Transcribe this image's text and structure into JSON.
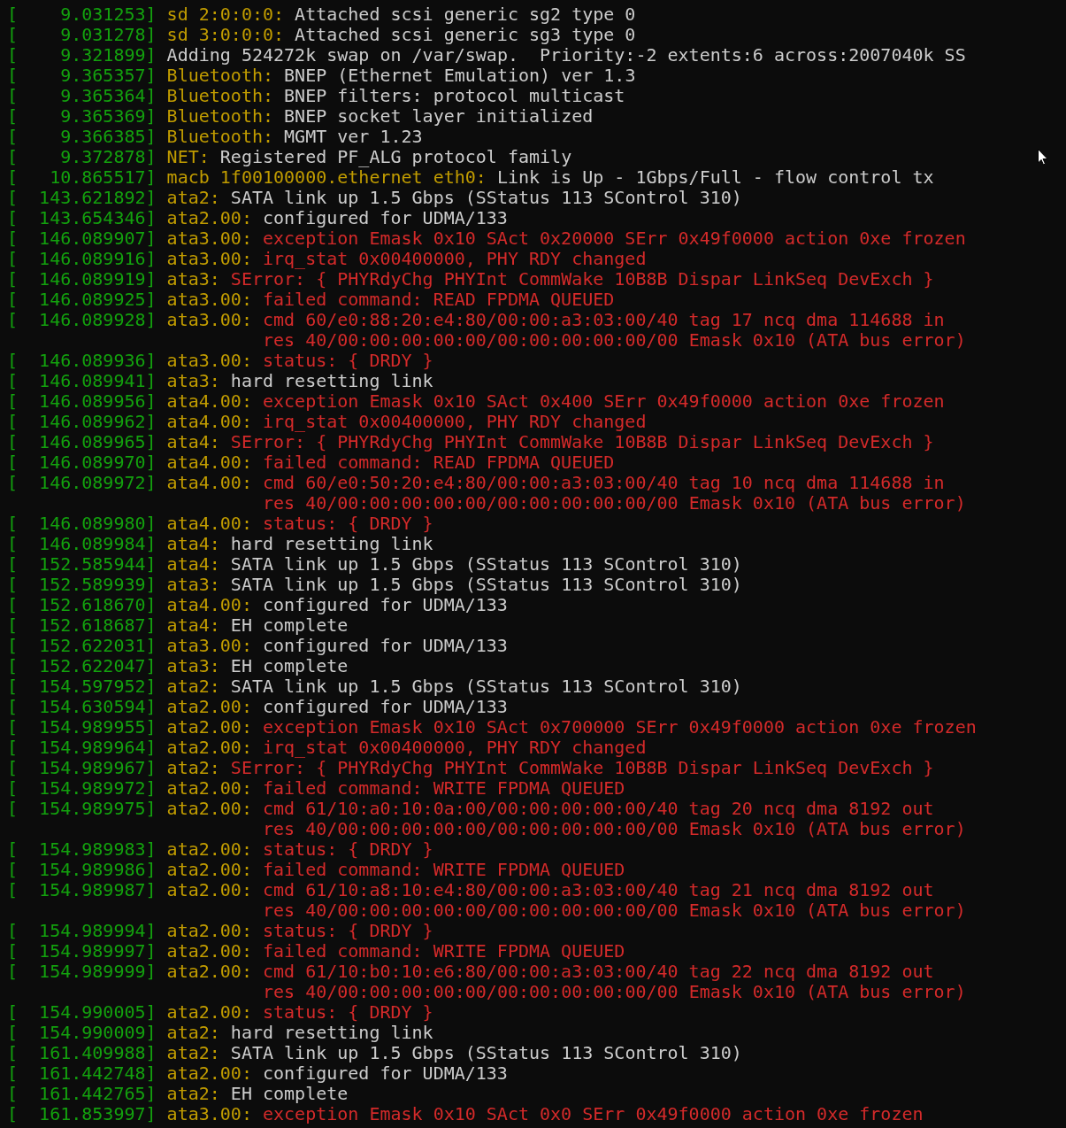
{
  "lines": [
    {
      "timestamp": "[    9.031253]",
      "source": "sd 2:0:0:0:",
      "message": "Attached scsi generic sg2 type 0",
      "kind": "info"
    },
    {
      "timestamp": "[    9.031278]",
      "source": "sd 3:0:0:0:",
      "message": "Attached scsi generic sg3 type 0",
      "kind": "info"
    },
    {
      "timestamp": "[    9.321899]",
      "message": "Adding 524272k swap on /var/swap.  Priority:-2 extents:6 across:2007040k SS",
      "kind": "info"
    },
    {
      "timestamp": "[    9.365357]",
      "source": "Bluetooth:",
      "message": "BNEP (Ethernet Emulation) ver 1.3",
      "kind": "info"
    },
    {
      "timestamp": "[    9.365364]",
      "source": "Bluetooth:",
      "message": "BNEP filters: protocol multicast",
      "kind": "info"
    },
    {
      "timestamp": "[    9.365369]",
      "source": "Bluetooth:",
      "message": "BNEP socket layer initialized",
      "kind": "info"
    },
    {
      "timestamp": "[    9.366385]",
      "source": "Bluetooth:",
      "message": "MGMT ver 1.23",
      "kind": "info"
    },
    {
      "timestamp": "[    9.372878]",
      "source": "NET:",
      "message": "Registered PF_ALG protocol family",
      "kind": "info"
    },
    {
      "timestamp": "[   10.865517]",
      "source": "macb 1f00100000.ethernet eth0:",
      "message": "Link is Up - 1Gbps/Full - flow control tx",
      "kind": "info"
    },
    {
      "timestamp": "[  143.621892]",
      "source": "ata2:",
      "message": "SATA link up 1.5 Gbps (SStatus 113 SControl 310)",
      "kind": "info"
    },
    {
      "timestamp": "[  143.654346]",
      "source": "ata2.00:",
      "message": "configured for UDMA/133",
      "kind": "info"
    },
    {
      "timestamp": "[  146.089907]",
      "source": "ata3.00:",
      "message": "exception Emask 0x10 SAct 0x20000 SErr 0x49f0000 action 0xe frozen",
      "kind": "error"
    },
    {
      "timestamp": "[  146.089916]",
      "source": "ata3.00:",
      "message": "irq_stat 0x00400000, PHY RDY changed",
      "kind": "error"
    },
    {
      "timestamp": "[  146.089919]",
      "source": "ata3:",
      "message": "SError: { PHYRdyChg PHYInt CommWake 10B8B Dispar LinkSeq DevExch }",
      "kind": "error"
    },
    {
      "timestamp": "[  146.089925]",
      "source": "ata3.00:",
      "message": "failed command: READ FPDMA QUEUED",
      "kind": "error"
    },
    {
      "timestamp": "[  146.089928]",
      "source": "ata3.00:",
      "message": "cmd 60/e0:88:20:e4:80/00:00:a3:03:00/40 tag 17 ncq dma 114688 in",
      "continued": "res 40/00:00:00:00:00/00:00:00:00:00/00 Emask 0x10 (ATA bus error)",
      "kind": "error"
    },
    {
      "timestamp": "[  146.089936]",
      "source": "ata3.00:",
      "message": "status: { DRDY }",
      "kind": "error"
    },
    {
      "timestamp": "[  146.089941]",
      "source": "ata3:",
      "message": "hard resetting link",
      "kind": "info"
    },
    {
      "timestamp": "[  146.089956]",
      "source": "ata4.00:",
      "message": "exception Emask 0x10 SAct 0x400 SErr 0x49f0000 action 0xe frozen",
      "kind": "error"
    },
    {
      "timestamp": "[  146.089962]",
      "source": "ata4.00:",
      "message": "irq_stat 0x00400000, PHY RDY changed",
      "kind": "error"
    },
    {
      "timestamp": "[  146.089965]",
      "source": "ata4:",
      "message": "SError: { PHYRdyChg PHYInt CommWake 10B8B Dispar LinkSeq DevExch }",
      "kind": "error"
    },
    {
      "timestamp": "[  146.089970]",
      "source": "ata4.00:",
      "message": "failed command: READ FPDMA QUEUED",
      "kind": "error"
    },
    {
      "timestamp": "[  146.089972]",
      "source": "ata4.00:",
      "message": "cmd 60/e0:50:20:e4:80/00:00:a3:03:00/40 tag 10 ncq dma 114688 in",
      "continued": "res 40/00:00:00:00:00/00:00:00:00:00/00 Emask 0x10 (ATA bus error)",
      "kind": "error"
    },
    {
      "timestamp": "[  146.089980]",
      "source": "ata4.00:",
      "message": "status: { DRDY }",
      "kind": "error"
    },
    {
      "timestamp": "[  146.089984]",
      "source": "ata4:",
      "message": "hard resetting link",
      "kind": "info"
    },
    {
      "timestamp": "[  152.585944]",
      "source": "ata4:",
      "message": "SATA link up 1.5 Gbps (SStatus 113 SControl 310)",
      "kind": "info"
    },
    {
      "timestamp": "[  152.589939]",
      "source": "ata3:",
      "message": "SATA link up 1.5 Gbps (SStatus 113 SControl 310)",
      "kind": "info"
    },
    {
      "timestamp": "[  152.618670]",
      "source": "ata4.00:",
      "message": "configured for UDMA/133",
      "kind": "info"
    },
    {
      "timestamp": "[  152.618687]",
      "source": "ata4:",
      "message": "EH complete",
      "kind": "info"
    },
    {
      "timestamp": "[  152.622031]",
      "source": "ata3.00:",
      "message": "configured for UDMA/133",
      "kind": "info"
    },
    {
      "timestamp": "[  152.622047]",
      "source": "ata3:",
      "message": "EH complete",
      "kind": "info"
    },
    {
      "timestamp": "[  154.597952]",
      "source": "ata2:",
      "message": "SATA link up 1.5 Gbps (SStatus 113 SControl 310)",
      "kind": "info"
    },
    {
      "timestamp": "[  154.630594]",
      "source": "ata2.00:",
      "message": "configured for UDMA/133",
      "kind": "info"
    },
    {
      "timestamp": "[  154.989955]",
      "source": "ata2.00:",
      "message": "exception Emask 0x10 SAct 0x700000 SErr 0x49f0000 action 0xe frozen",
      "kind": "error"
    },
    {
      "timestamp": "[  154.989964]",
      "source": "ata2.00:",
      "message": "irq_stat 0x00400000, PHY RDY changed",
      "kind": "error"
    },
    {
      "timestamp": "[  154.989967]",
      "source": "ata2:",
      "message": "SError: { PHYRdyChg PHYInt CommWake 10B8B Dispar LinkSeq DevExch }",
      "kind": "error"
    },
    {
      "timestamp": "[  154.989972]",
      "source": "ata2.00:",
      "message": "failed command: WRITE FPDMA QUEUED",
      "kind": "error"
    },
    {
      "timestamp": "[  154.989975]",
      "source": "ata2.00:",
      "message": "cmd 61/10:a0:10:0a:00/00:00:00:00:00/40 tag 20 ncq dma 8192 out",
      "continued": "res 40/00:00:00:00:00/00:00:00:00:00/00 Emask 0x10 (ATA bus error)",
      "kind": "error"
    },
    {
      "timestamp": "[  154.989983]",
      "source": "ata2.00:",
      "message": "status: { DRDY }",
      "kind": "error"
    },
    {
      "timestamp": "[  154.989986]",
      "source": "ata2.00:",
      "message": "failed command: WRITE FPDMA QUEUED",
      "kind": "error"
    },
    {
      "timestamp": "[  154.989987]",
      "source": "ata2.00:",
      "message": "cmd 61/10:a8:10:e4:80/00:00:a3:03:00/40 tag 21 ncq dma 8192 out",
      "continued": "res 40/00:00:00:00:00/00:00:00:00:00/00 Emask 0x10 (ATA bus error)",
      "kind": "error"
    },
    {
      "timestamp": "[  154.989994]",
      "source": "ata2.00:",
      "message": "status: { DRDY }",
      "kind": "error"
    },
    {
      "timestamp": "[  154.989997]",
      "source": "ata2.00:",
      "message": "failed command: WRITE FPDMA QUEUED",
      "kind": "error"
    },
    {
      "timestamp": "[  154.989999]",
      "source": "ata2.00:",
      "message": "cmd 61/10:b0:10:e6:80/00:00:a3:03:00/40 tag 22 ncq dma 8192 out",
      "continued": "res 40/00:00:00:00:00/00:00:00:00:00/00 Emask 0x10 (ATA bus error)",
      "kind": "error"
    },
    {
      "timestamp": "[  154.990005]",
      "source": "ata2.00:",
      "message": "status: { DRDY }",
      "kind": "error"
    },
    {
      "timestamp": "[  154.990009]",
      "source": "ata2:",
      "message": "hard resetting link",
      "kind": "info"
    },
    {
      "timestamp": "[  161.409988]",
      "source": "ata2:",
      "message": "SATA link up 1.5 Gbps (SStatus 113 SControl 310)",
      "kind": "info"
    },
    {
      "timestamp": "[  161.442748]",
      "source": "ata2.00:",
      "message": "configured for UDMA/133",
      "kind": "info"
    },
    {
      "timestamp": "[  161.442765]",
      "source": "ata2:",
      "message": "EH complete",
      "kind": "info"
    },
    {
      "timestamp": "[  161.853997]",
      "source": "ata3.00:",
      "message": "exception Emask 0x10 SAct 0x0 SErr 0x49f0000 action 0xe frozen",
      "kind": "error"
    }
  ]
}
